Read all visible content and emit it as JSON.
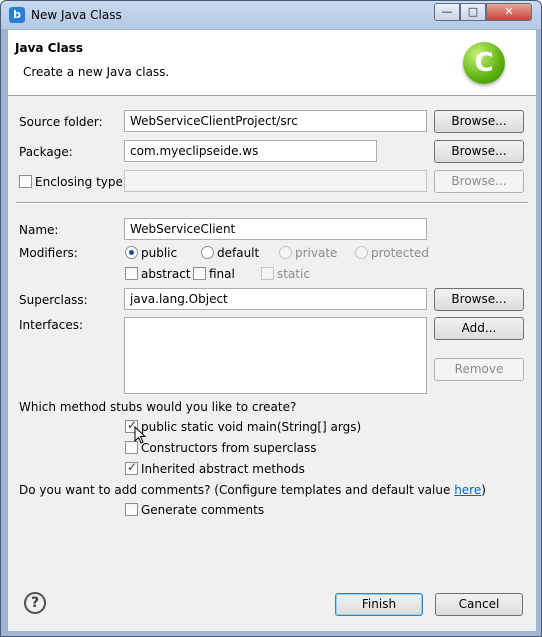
{
  "window": {
    "title": "New Java Class",
    "app_icon": "b"
  },
  "header": {
    "title": "Java Class",
    "description": "Create a new Java class.",
    "logo_letter": "C"
  },
  "source_folder": {
    "label": "Source folder:",
    "value": "WebServiceClientProject/src",
    "browse": "Browse..."
  },
  "package": {
    "label": "Package:",
    "value": "com.myeclipseide.ws",
    "browse": "Browse..."
  },
  "enclosing_type": {
    "label": "Enclosing type:",
    "value": "",
    "browse": "Browse..."
  },
  "name": {
    "label": "Name:",
    "value": "WebServiceClient"
  },
  "modifiers": {
    "label": "Modifiers:",
    "public": "public",
    "default": "default",
    "private": "private",
    "protected": "protected",
    "abstract": "abstract",
    "final": "final",
    "static": "static"
  },
  "superclass": {
    "label": "Superclass:",
    "value": "java.lang.Object",
    "browse": "Browse..."
  },
  "interfaces": {
    "label": "Interfaces:",
    "add": "Add...",
    "remove": "Remove"
  },
  "stubs": {
    "question": "Which method stubs would you like to create?",
    "main": "public static void main(String[] args)",
    "constructors": "Constructors from superclass",
    "inherited": "Inherited abstract methods"
  },
  "comments": {
    "question_prefix": "Do you want to add comments? (Configure templates and default value ",
    "link": "here",
    "question_suffix": ")",
    "generate": "Generate comments"
  },
  "footer": {
    "finish": "Finish",
    "cancel": "Cancel"
  }
}
